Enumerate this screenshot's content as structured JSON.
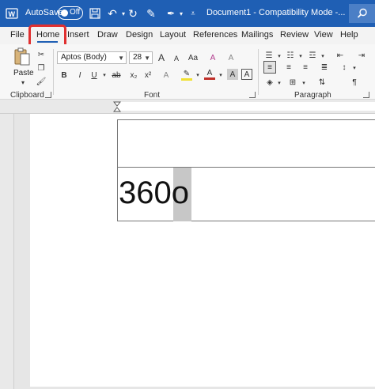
{
  "titlebar": {
    "autosave_label": "AutoSave",
    "toggle_state": "Off",
    "document_title": "Document1 - Compatibility Mode -...",
    "icons": [
      "word-logo-icon",
      "save-icon",
      "undo-icon",
      "undo-dropdown-icon",
      "redo-icon",
      "draw-pen-icon",
      "pen-dropdown-icon",
      "customize-toolbar-icon",
      "search-icon"
    ]
  },
  "tabs": {
    "file": "File",
    "home": "Home",
    "insert": "Insert",
    "draw": "Draw",
    "design": "Design",
    "layout": "Layout",
    "references": "References",
    "mailings": "Mailings",
    "review": "Review",
    "view": "View",
    "help": "Help"
  },
  "ribbon": {
    "clipboard": {
      "group_label": "Clipboard",
      "paste_label": "Paste"
    },
    "font": {
      "group_label": "Font",
      "font_name": "Aptos (Body)",
      "font_size": "28",
      "bold": "B",
      "italic": "I",
      "underline": "U",
      "strikethrough": "ab",
      "subscript": "x₂",
      "superscript": "x²",
      "grow_font": "A",
      "shrink_font": "A",
      "change_case": "Aa",
      "clear_format": "A",
      "text_effects": "A",
      "highlight": "✎",
      "font_color": "A",
      "char_shading": "A",
      "char_border": "A"
    },
    "paragraph": {
      "group_label": "Paragraph",
      "pilcrow": "¶"
    }
  },
  "document": {
    "cell_text": "360o"
  },
  "colors": {
    "title_bar": "#1f5fb4",
    "annotation": "#e03030",
    "selection": "#c7c7c7"
  }
}
